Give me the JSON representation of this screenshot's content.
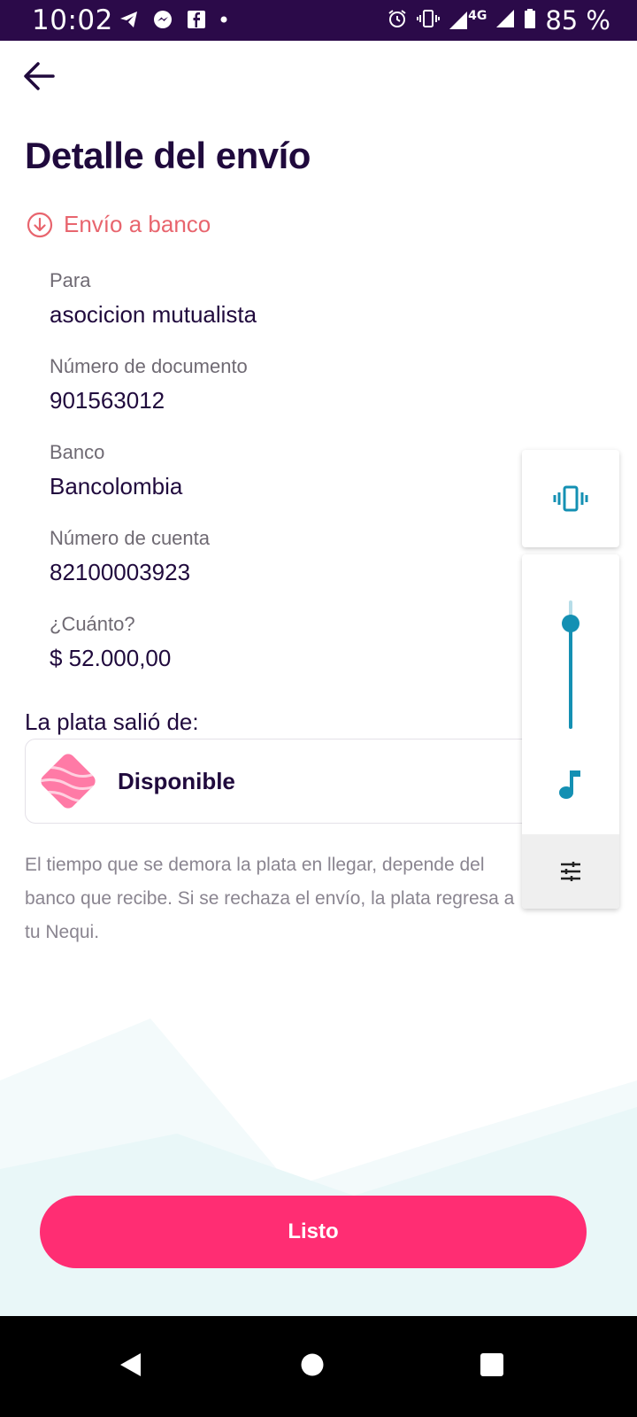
{
  "status_bar": {
    "time": "10:02",
    "network": "4G",
    "battery": "85 %",
    "left_icons": [
      "telegram-icon",
      "messenger-icon",
      "facebook-icon",
      "dot-icon"
    ],
    "right_icons": [
      "alarm-icon",
      "vibrate-icon",
      "signal-icon",
      "signal-icon",
      "battery-icon"
    ]
  },
  "header": {
    "title": "Detalle del envío"
  },
  "transfer_type": {
    "label": "Envío a banco",
    "icon": "arrow-down-circle-icon",
    "color": "#e8656e"
  },
  "details": [
    {
      "label": "Para",
      "value": "asocicion mutualista"
    },
    {
      "label": "Número de documento",
      "value": "901563012"
    },
    {
      "label": "Banco",
      "value": "Bancolombia"
    },
    {
      "label": "Número de cuenta",
      "value": "82100003923"
    },
    {
      "label": "¿Cuánto?",
      "value": "$ 52.000,00"
    }
  ],
  "source": {
    "title": "La plata salió de:",
    "account": "Disponible"
  },
  "info": {
    "line1": "El tiempo que se demora la plata en llegar, depende del",
    "line2": "banco que recibe. Si se rechaza el envío, la plata regresa a",
    "line3": "tu Nequi."
  },
  "actions": {
    "done_label": "Listo"
  },
  "volume_panel": {
    "level": 0.82,
    "top_icon": "vibrate-icon",
    "stream_icon": "music-note-icon",
    "settings_icon": "sliders-icon",
    "accent": "#1490b3"
  },
  "colors": {
    "primary": "#200a3d",
    "accent": "#ff2d73",
    "status_bar": "#2b0a49"
  }
}
